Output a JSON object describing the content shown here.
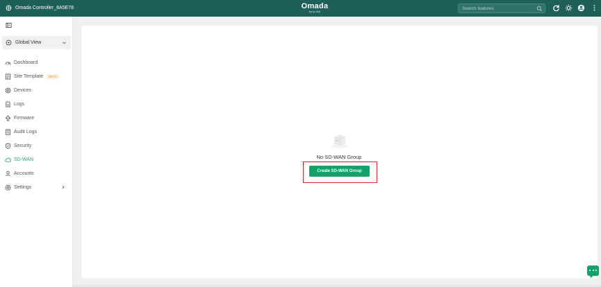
{
  "topbar": {
    "controller_name": "Omada Controller_8A5E78",
    "brand_name": "Omada",
    "brand_sub": "by tp-link",
    "search_placeholder": "Search features",
    "icons": [
      "controller-icon",
      "search-icon",
      "refresh-icon",
      "theme-sun-icon",
      "user-avatar-icon",
      "more-vertical-icon"
    ]
  },
  "sidebar": {
    "collapse_icon": "sidebar-collapse-icon",
    "site_selector": {
      "label": "Global View",
      "icon": "location-pin-icon"
    },
    "items": [
      {
        "label": "Dashboard",
        "icon": "dashboard-icon"
      },
      {
        "label": "Site Template",
        "icon": "template-icon",
        "badge": "BETA"
      },
      {
        "label": "Devices",
        "icon": "devices-icon"
      },
      {
        "label": "Logs",
        "icon": "logs-icon"
      },
      {
        "label": "Firmware",
        "icon": "firmware-upload-icon"
      },
      {
        "label": "Audit Logs",
        "icon": "audit-logs-icon"
      },
      {
        "label": "Security",
        "icon": "shield-icon"
      },
      {
        "label": "SD-WAN",
        "icon": "cloud-icon",
        "active": true
      },
      {
        "label": "Accounts",
        "icon": "user-icon"
      },
      {
        "label": "Settings",
        "icon": "gear-icon",
        "has_submenu": true
      }
    ]
  },
  "main": {
    "empty_title": "No SD-WAN Group",
    "create_button_label": "Create SD-WAN Group"
  },
  "colors": {
    "topbar": "#1f5f5a",
    "accent": "#10a36a",
    "active_nav": "#2fa37a",
    "highlight": "#d9232e"
  }
}
